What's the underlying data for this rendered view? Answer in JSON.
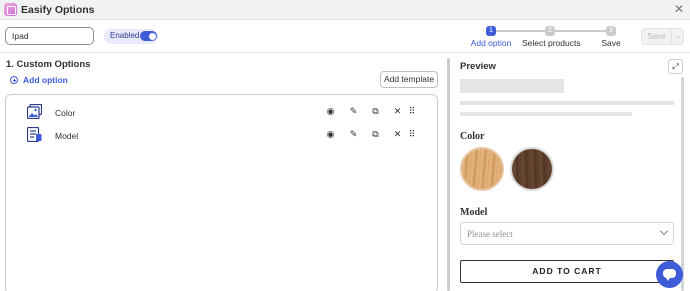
{
  "window": {
    "title": "Easify Options",
    "close_icon": "close-icon"
  },
  "header": {
    "search_value": "Ipad",
    "enabled_label": "Enabled",
    "enabled": true,
    "steps": [
      {
        "num": "1",
        "label": "Add option",
        "active": true
      },
      {
        "num": "2",
        "label": "Select products",
        "active": false
      },
      {
        "num": "3",
        "label": "Save",
        "active": false
      }
    ],
    "save_label": "Save"
  },
  "left": {
    "section_title": "1. Custom Options",
    "add_option_label": "Add option",
    "add_template_label": "Add template",
    "options": [
      {
        "name": "Color",
        "icon": "image-swatch-icon"
      },
      {
        "name": "Model",
        "icon": "dropdown-form-icon"
      }
    ],
    "row_actions": [
      "eye-icon",
      "pencil-icon",
      "duplicate-icon",
      "delete-icon",
      "drag-handle-icon"
    ]
  },
  "preview": {
    "title": "Preview",
    "color_label": "Color",
    "swatches": [
      {
        "name": "light-oak",
        "color": "#dcaa72"
      },
      {
        "name": "dark-walnut",
        "color": "#5d3f2c"
      }
    ],
    "model_label": "Model",
    "model_placeholder": "Please select",
    "add_to_cart_label": "ADD TO CART"
  },
  "colors": {
    "accent": "#3e5bd8",
    "text": "#303030",
    "border": "#c9cccf"
  }
}
